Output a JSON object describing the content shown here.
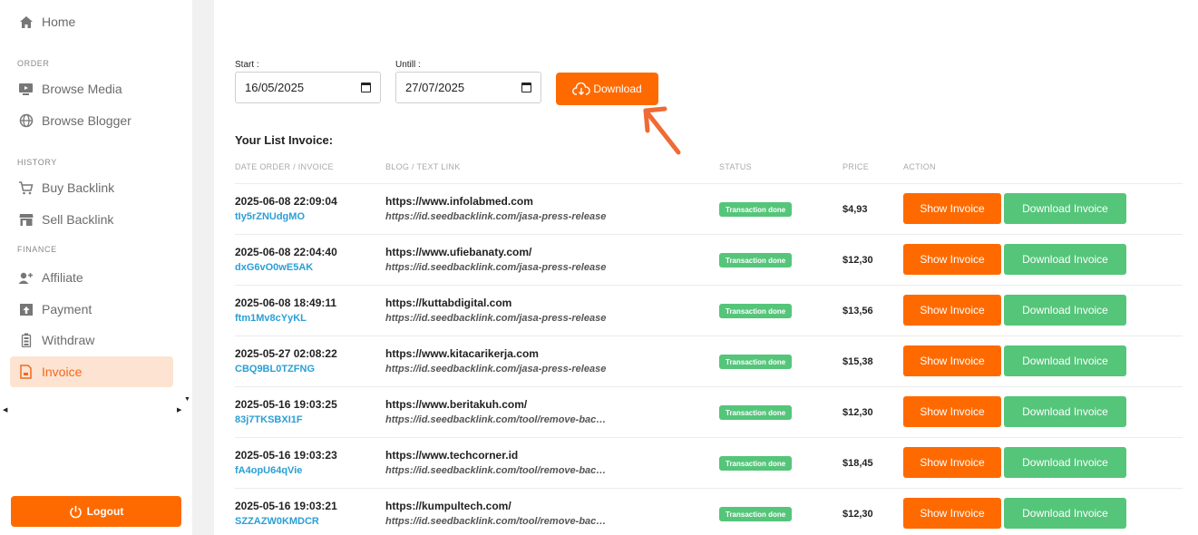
{
  "sidebar": {
    "home": "Home",
    "sections": {
      "order": "ORDER",
      "history": "HISTORY",
      "finance": "FINANCE"
    },
    "items": {
      "browse_media": "Browse Media",
      "browse_blogger": "Browse Blogger",
      "buy_backlink": "Buy Backlink",
      "sell_backlink": "Sell Backlink",
      "affiliate": "Affiliate",
      "payment": "Payment",
      "withdraw": "Withdraw",
      "invoice": "Invoice"
    },
    "logout": "Logout"
  },
  "filter": {
    "start_label": "Start :",
    "start_value": "16/05/2025",
    "until_label": "Untill :",
    "until_value": "27/07/2025",
    "download": "Download"
  },
  "table": {
    "title": "Your List Invoice:",
    "headers": [
      "DATE ORDER / INVOICE",
      "BLOG / TEXT LINK",
      "STATUS",
      "PRICE",
      "ACTION"
    ],
    "show_label": "Show Invoice",
    "download_label": "Download Invoice",
    "rows": [
      {
        "date": "2025-06-08 22:09:04",
        "invoice": "tIy5rZNUdgMO",
        "url": "https://www.infolabmed.com",
        "text": "https://id.seedbacklink.com/jasa-press-release",
        "status": "Transaction done",
        "price": "$4,93"
      },
      {
        "date": "2025-06-08 22:04:40",
        "invoice": "dxG6vO0wE5AK",
        "url": "https://www.ufiebanaty.com/",
        "text": "https://id.seedbacklink.com/jasa-press-release",
        "status": "Transaction done",
        "price": "$12,30"
      },
      {
        "date": "2025-06-08 18:49:11",
        "invoice": "ftm1Mv8cYyKL",
        "url": "https://kuttabdigital.com",
        "text": "https://id.seedbacklink.com/jasa-press-release",
        "status": "Transaction done",
        "price": "$13,56"
      },
      {
        "date": "2025-05-27 02:08:22",
        "invoice": "CBQ9BL0TZFNG",
        "url": "https://www.kitacarikerja.com",
        "text": "https://id.seedbacklink.com/jasa-press-release",
        "status": "Transaction done",
        "price": "$15,38"
      },
      {
        "date": "2025-05-16 19:03:25",
        "invoice": "83j7TKSBXI1F",
        "url": "https://www.beritakuh.com/",
        "text": "https://id.seedbacklink.com/tool/remove-bac…",
        "status": "Transaction done",
        "price": "$12,30"
      },
      {
        "date": "2025-05-16 19:03:23",
        "invoice": "fA4opU64qVie",
        "url": "https://www.techcorner.id",
        "text": "https://id.seedbacklink.com/tool/remove-bac…",
        "status": "Transaction done",
        "price": "$18,45"
      },
      {
        "date": "2025-05-16 19:03:21",
        "invoice": "SZZAZW0KMDCR",
        "url": "https://kumpultech.com/",
        "text": "https://id.seedbacklink.com/tool/remove-bac…",
        "status": "Transaction done",
        "price": "$12,30"
      }
    ]
  },
  "colors": {
    "accent": "#ff6a00",
    "success": "#55c57a",
    "link": "#2a9fd6",
    "active_bg": "#fde3d2"
  }
}
